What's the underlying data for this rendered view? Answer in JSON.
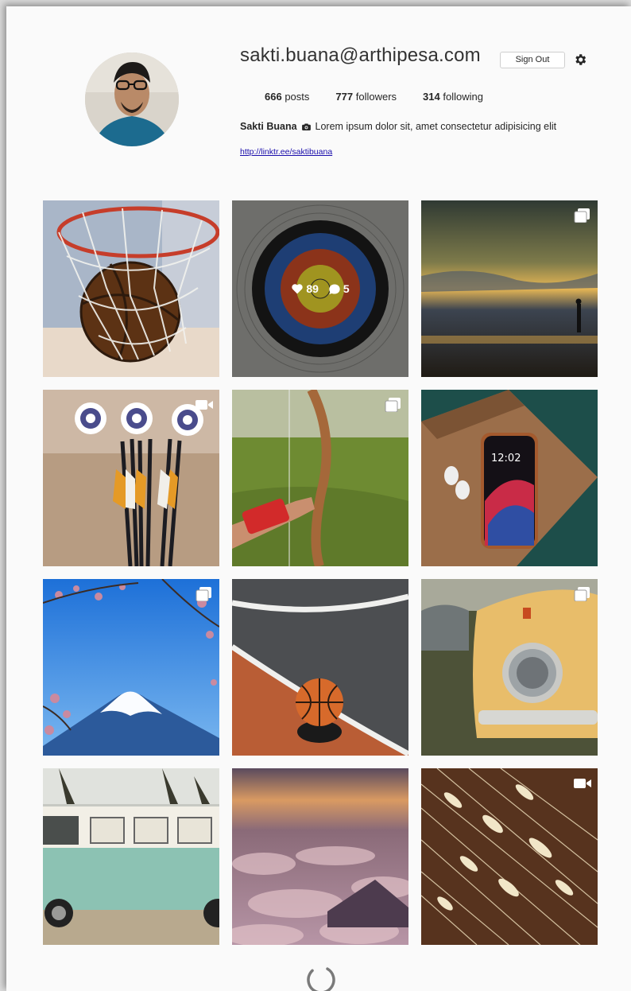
{
  "profile": {
    "username": "sakti.buana@arthipesa.com",
    "sign_out_label": "Sign Out",
    "stats": {
      "posts_count": "666",
      "posts_label": "posts",
      "followers_count": "777",
      "followers_label": "followers",
      "following_count": "314",
      "following_label": "following"
    },
    "full_name": "Sakti Buana",
    "bio": "Lorem ipsum dolor sit, amet consectetur adipisicing elit",
    "link": "http://linktr.ee/saktibuana"
  },
  "grid": {
    "hover_overlay": {
      "likes": "89",
      "comments": "5"
    },
    "posts": [
      {
        "subject": "basketball-hoop",
        "type": "image"
      },
      {
        "subject": "archery-target",
        "type": "image"
      },
      {
        "subject": "sunset-archer",
        "type": "carousel"
      },
      {
        "subject": "arrows",
        "type": "video"
      },
      {
        "subject": "bow-archer",
        "type": "carousel"
      },
      {
        "subject": "phone-airpods",
        "type": "image"
      },
      {
        "subject": "mount-fuji",
        "type": "carousel"
      },
      {
        "subject": "basketball-court",
        "type": "image"
      },
      {
        "subject": "yellow-beetle",
        "type": "carousel"
      },
      {
        "subject": "vw-bus",
        "type": "image"
      },
      {
        "subject": "clouds-sunset",
        "type": "image"
      },
      {
        "subject": "dry-grass",
        "type": "video"
      }
    ]
  },
  "phone_clock": "12:02"
}
